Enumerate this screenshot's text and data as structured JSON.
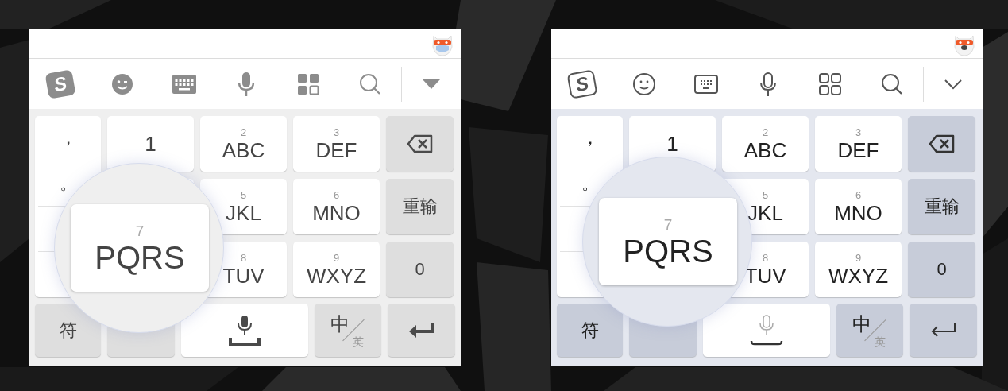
{
  "panels": [
    {
      "kind": "filled",
      "logo": "S",
      "punctuation": [
        "，",
        "。"
      ],
      "rows": [
        [
          {
            "kind": "char",
            "label": "1"
          },
          {
            "kind": "char",
            "digit": "2",
            "label": "ABC"
          },
          {
            "kind": "char",
            "digit": "3",
            "label": "DEF"
          },
          {
            "kind": "backspace"
          }
        ],
        [
          {
            "kind": "covered"
          },
          {
            "kind": "char",
            "digit": "5",
            "label": "JKL"
          },
          {
            "kind": "char",
            "digit": "6",
            "label": "MNO"
          },
          {
            "kind": "fn",
            "label": "重输"
          }
        ],
        [
          {
            "kind": "covered"
          },
          {
            "kind": "char",
            "digit": "8",
            "label": "TUV"
          },
          {
            "kind": "char",
            "digit": "9",
            "label": "WXYZ"
          },
          {
            "kind": "fn",
            "label": "0"
          }
        ]
      ],
      "bottom": [
        {
          "kind": "fn",
          "label": "符"
        },
        {
          "kind": "fn"
        },
        {
          "kind": "space"
        },
        {
          "kind": "lang",
          "label": "中",
          "sub": "英"
        },
        {
          "kind": "enter"
        }
      ],
      "magnifier": {
        "digit": "7",
        "label": "PQRS"
      }
    },
    {
      "kind": "outline",
      "logo": "S",
      "punctuation": [
        "，",
        "。"
      ],
      "rows": [
        [
          {
            "kind": "char",
            "label": "1"
          },
          {
            "kind": "char",
            "digit": "2",
            "label": "ABC"
          },
          {
            "kind": "char",
            "digit": "3",
            "label": "DEF"
          },
          {
            "kind": "backspace"
          }
        ],
        [
          {
            "kind": "covered"
          },
          {
            "kind": "char",
            "digit": "5",
            "label": "JKL"
          },
          {
            "kind": "char",
            "digit": "6",
            "label": "MNO"
          },
          {
            "kind": "fn",
            "label": "重输"
          }
        ],
        [
          {
            "kind": "covered"
          },
          {
            "kind": "char",
            "digit": "8",
            "label": "TUV"
          },
          {
            "kind": "char",
            "digit": "9",
            "label": "WXYZ"
          },
          {
            "kind": "fn",
            "label": "0"
          }
        ]
      ],
      "bottom": [
        {
          "kind": "fn",
          "label": "符"
        },
        {
          "kind": "fn"
        },
        {
          "kind": "space"
        },
        {
          "kind": "lang",
          "label": "中",
          "sub": "英"
        },
        {
          "kind": "enter"
        }
      ],
      "magnifier": {
        "digit": "7",
        "label": "PQRS"
      }
    }
  ]
}
